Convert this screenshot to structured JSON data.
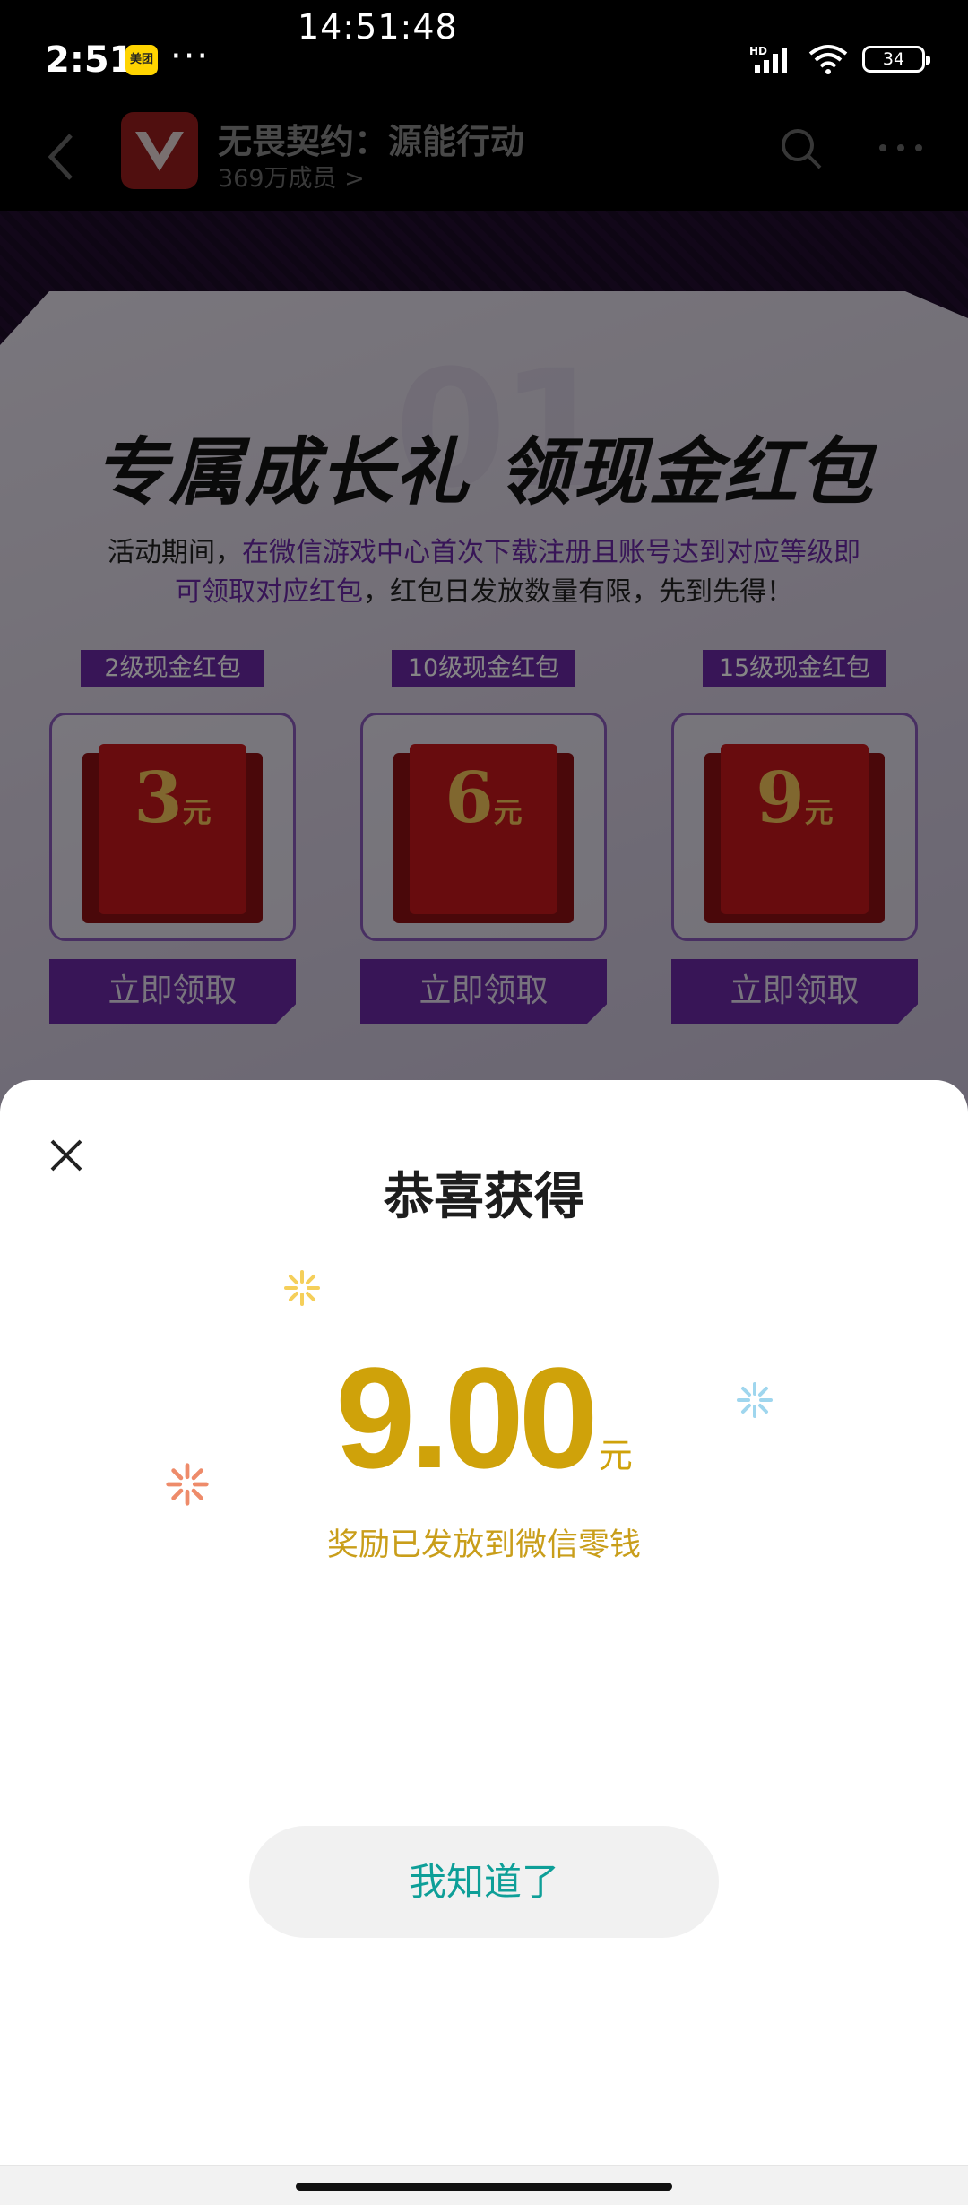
{
  "overlay_clock": "14:51:48",
  "status_bar": {
    "time": "2:51",
    "app_badge": "美团",
    "more": "···",
    "network": "HD",
    "battery": "34"
  },
  "header": {
    "title": "无畏契约：源能行动",
    "members": "369万成员 >"
  },
  "promo": {
    "headline": "专属成长礼 领现金红包",
    "desc_prefix": "活动期间，",
    "desc_highlight": "在微信游戏中心首次下载注册且账号达到对应等级即可领取对应红包",
    "desc_suffix": "，红包日发放数量有限，先到先得！",
    "rewards": [
      {
        "tag": "2级现金红包",
        "amount": "3",
        "unit": "元",
        "button": "立即领取"
      },
      {
        "tag": "10级现金红包",
        "amount": "6",
        "unit": "元",
        "button": "立即领取"
      },
      {
        "tag": "15级现金红包",
        "amount": "9",
        "unit": "元",
        "button": "立即领取"
      }
    ]
  },
  "sheet": {
    "title": "恭喜获得",
    "amount": "9.00",
    "unit": "元",
    "note": "奖励已发放到微信零钱",
    "confirm_label": "我知道了"
  },
  "colors": {
    "amount_gold": "#cfa20a",
    "button_text": "#0e9f98",
    "promo_purple": "#6b2aa8",
    "packet_red": "#c8181c"
  }
}
